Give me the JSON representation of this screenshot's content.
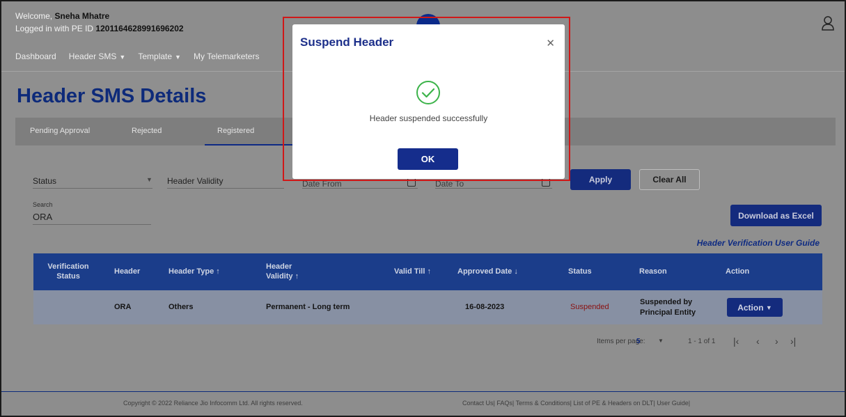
{
  "header": {
    "welcome_prefix": "Welcome,",
    "user_name": "Sneha Mhatre",
    "login_prefix": "Logged in with PE ID",
    "pe_id": "1201164628991696202"
  },
  "nav": {
    "items": [
      {
        "label": "Dashboard"
      },
      {
        "label": "Header SMS"
      },
      {
        "label": "Template"
      },
      {
        "label": "My Telemarketers"
      }
    ]
  },
  "page": {
    "title": "Header SMS Details"
  },
  "tabs": [
    {
      "label": "Pending Approval"
    },
    {
      "label": "Rejected"
    },
    {
      "label": "Registered"
    }
  ],
  "filters": {
    "status_label": "Status",
    "validity_label": "Header Validity",
    "date_from_label": "Date From",
    "date_to_label": "Date To",
    "apply_label": "Apply",
    "clear_label": "Clear All",
    "search_label": "Search",
    "search_value": "ORA",
    "download_label": "Download as Excel"
  },
  "guide_link": "Header Verification User Guide",
  "table": {
    "columns": {
      "verification_status": "Verification Status",
      "header": "Header",
      "header_type": "Header Type",
      "header_validity": "Header Validity",
      "valid_till": "Valid Till",
      "approved_date": "Approved Date",
      "status": "Status",
      "reason": "Reason",
      "action": "Action"
    },
    "rows": [
      {
        "verification_status": "",
        "header": "ORA",
        "header_type": "Others",
        "header_validity": "Permanent - Long term",
        "valid_till": "",
        "approved_date": "16-08-2023",
        "status": "Suspended",
        "reason": "Suspended by Principal Entity",
        "action": "Action"
      }
    ]
  },
  "pagination": {
    "items_per_page_label": "Items per page:",
    "items_per_page": "5",
    "range": "1 - 1 of 1"
  },
  "footer": {
    "copyright": "Copyright © 2022 Reliance Jio Infocomm Ltd. All rights reserved.",
    "links": [
      "Contact Us",
      "FAQs",
      "Terms & Conditions",
      "List of PE & Headers on DLT",
      "User Guide"
    ]
  },
  "modal": {
    "title": "Suspend Header",
    "message": "Header suspended successfully",
    "ok_label": "OK"
  },
  "colors": {
    "brand": "#0d2a7a",
    "table_header": "#1b3d8a",
    "suspended": "#8a1010",
    "highlight": "#d01818"
  }
}
